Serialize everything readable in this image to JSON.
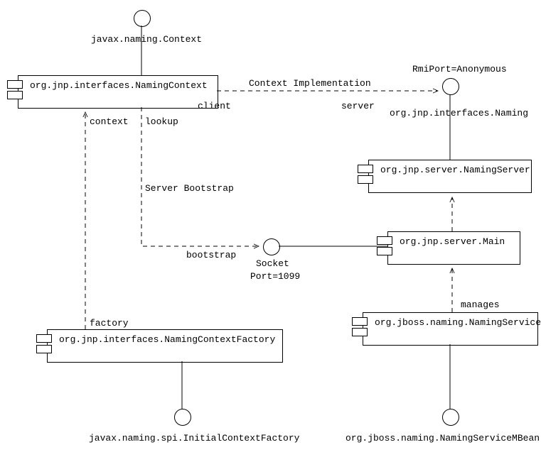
{
  "components": {
    "namingContext": "org.jnp.interfaces.NamingContext",
    "namingServer": "org.jnp.server.NamingServer",
    "main": "org.jnp.server.Main",
    "namingService": "org.jboss.naming.NamingService",
    "namingContextFactory": "org.jnp.interfaces.NamingContextFactory"
  },
  "interfaces": {
    "context": "javax.naming.Context",
    "naming": "org.jnp.interfaces.Naming",
    "socket": "Socket",
    "initialContextFactory": "javax.naming.spi.InitialContextFactory",
    "namingServiceMBean": "org.jboss.naming.NamingServiceMBean"
  },
  "labels": {
    "rmiPort": "RmiPort=Anonymous",
    "port": "Port=1099",
    "contextImplementation": "Context Implementation",
    "client": "client",
    "server": "server",
    "contextRole": "context",
    "lookup": "lookup",
    "serverBootstrap": "Server Bootstrap",
    "bootstrap": "bootstrap",
    "factory": "factory",
    "manages": "manages"
  }
}
